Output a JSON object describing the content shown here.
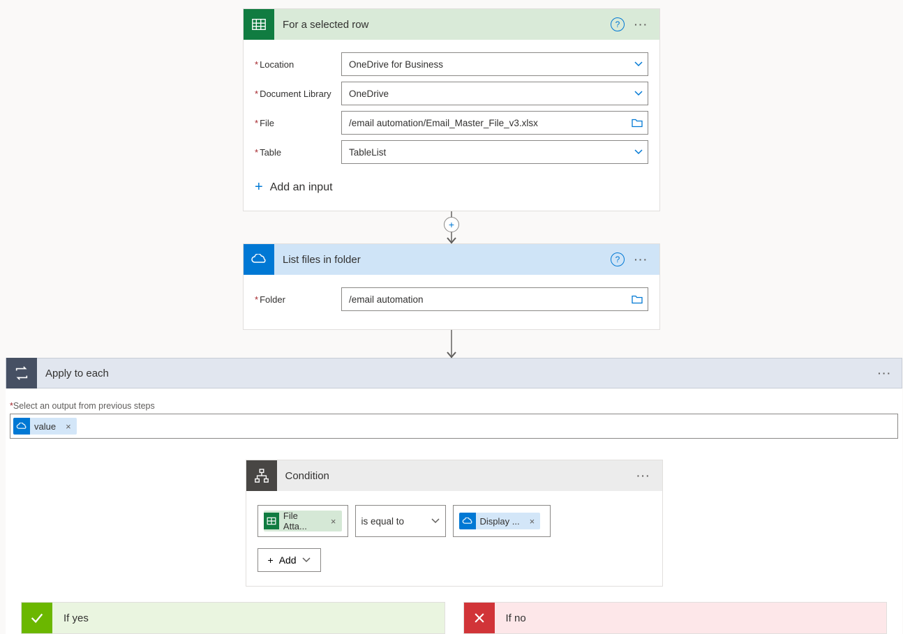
{
  "trigger": {
    "title": "For a selected row",
    "fields": {
      "location": {
        "label": "Location",
        "value": "OneDrive for Business"
      },
      "library": {
        "label": "Document Library",
        "value": "OneDrive"
      },
      "file": {
        "label": "File",
        "value": "/email automation/Email_Master_File_v3.xlsx"
      },
      "table": {
        "label": "Table",
        "value": "TableList"
      }
    },
    "add_input": "Add an input"
  },
  "action1": {
    "title": "List files in folder",
    "folder_label": "Folder",
    "folder_value": "/email automation"
  },
  "loop": {
    "title": "Apply to each",
    "output_label": "Select an output from previous steps",
    "token_value": "value"
  },
  "condition": {
    "title": "Condition",
    "left_token": "File Atta...",
    "operator": "is equal to",
    "right_token": "Display ...",
    "add_label": "Add"
  },
  "branches": {
    "yes": "If yes",
    "no": "If no"
  }
}
